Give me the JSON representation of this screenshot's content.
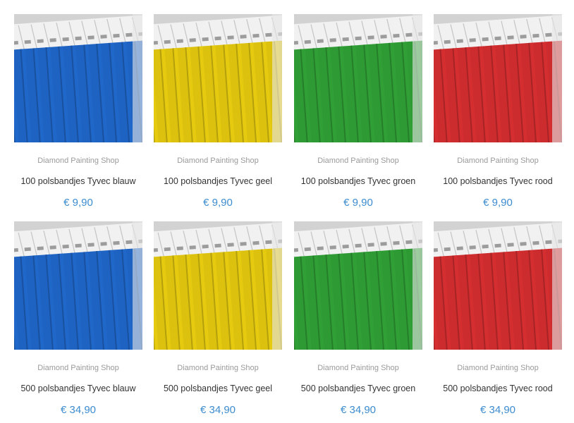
{
  "products": [
    {
      "vendor": "Diamond Painting Shop",
      "title": "100 polsbandjes Tyvec blauw",
      "price": "€ 9,90",
      "color": "#1f63c2",
      "image": "blue-wristbands-image"
    },
    {
      "vendor": "Diamond Painting Shop",
      "title": "100 polsbandjes Tyvec geel",
      "price": "€ 9,90",
      "color": "#dcc20f",
      "image": "yellow-wristbands-image"
    },
    {
      "vendor": "Diamond Painting Shop",
      "title": "100 polsbandjes Tyvec groen",
      "price": "€ 9,90",
      "color": "#2e9a34",
      "image": "green-wristbands-image"
    },
    {
      "vendor": "Diamond Painting Shop",
      "title": "100 polsbandjes Tyvec rood",
      "price": "€ 9,90",
      "color": "#cc2c2e",
      "image": "red-wristbands-image"
    },
    {
      "vendor": "Diamond Painting Shop",
      "title": "500 polsbandjes Tyvec blauw",
      "price": "€ 34,90",
      "color": "#1f63c2",
      "image": "blue-wristbands-image"
    },
    {
      "vendor": "Diamond Painting Shop",
      "title": "500 polsbandjes Tyvec geel",
      "price": "€ 34,90",
      "color": "#dcc20f",
      "image": "yellow-wristbands-image"
    },
    {
      "vendor": "Diamond Painting Shop",
      "title": "500 polsbandjes Tyvec groen",
      "price": "€ 34,90",
      "color": "#2e9a34",
      "image": "green-wristbands-image"
    },
    {
      "vendor": "Diamond Painting Shop",
      "title": "500 polsbandjes Tyvec rood",
      "price": "€ 34,90",
      "color": "#cc2c2e",
      "image": "red-wristbands-image"
    }
  ],
  "theme": {
    "price_color": "#3d8ccf",
    "vendor_color": "#9a9a9a",
    "title_color": "#333333"
  }
}
